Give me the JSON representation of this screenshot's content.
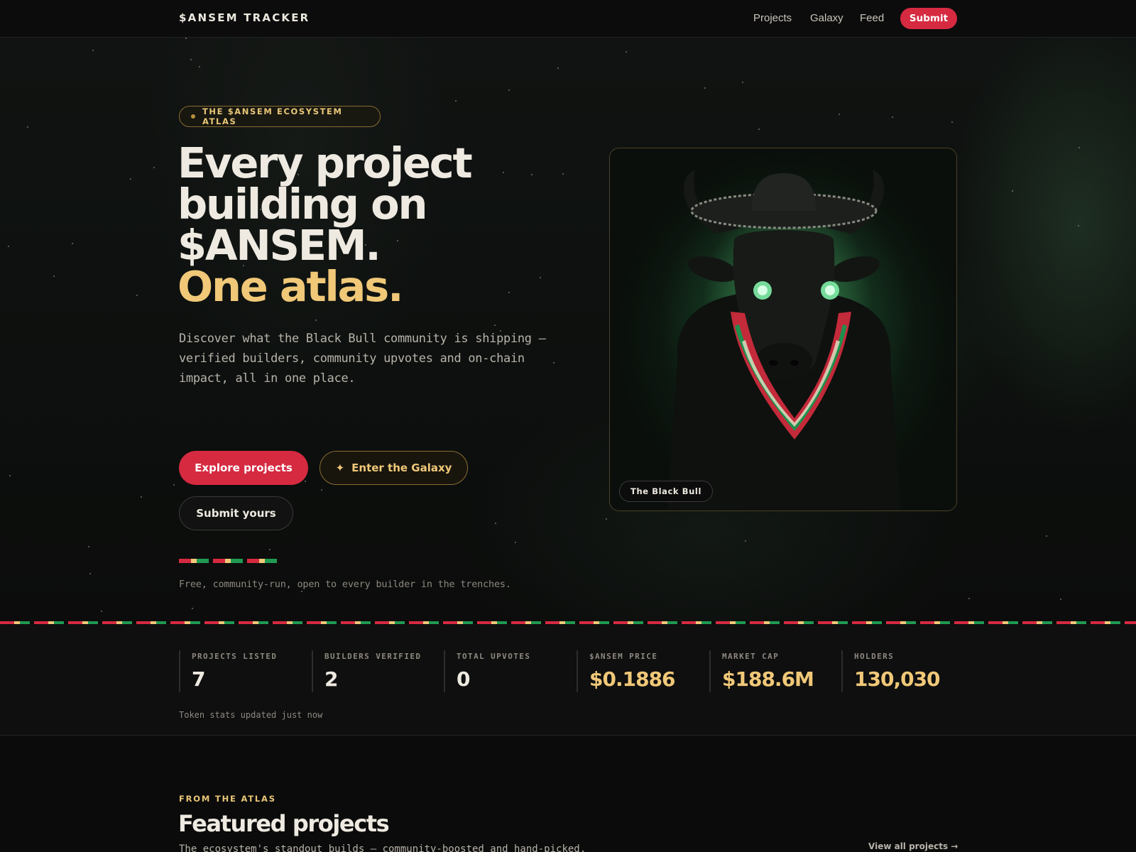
{
  "nav": {
    "brand": "$ANSEM TRACKER",
    "links": [
      "Projects",
      "Galaxy",
      "Feed"
    ],
    "submit_label": "Submit"
  },
  "hero": {
    "eyebrow": "THE $ANSEM ECOSYSTEM ATLAS",
    "headline_lines": [
      "Every project",
      "building on",
      "$ANSEM."
    ],
    "headline_accent": "One atlas.",
    "lede": "Discover what the Black Bull community is shipping — verified builders, community upvotes and on-chain impact, all in one place.",
    "buttons": {
      "explore": "Explore projects",
      "galaxy": "Enter the Galaxy",
      "submit": "Submit yours"
    },
    "galaxy_icon": "sparkle-icon",
    "footnote": "Free, community-run, open to every builder in the trenches.",
    "image_caption": "The Black Bull"
  },
  "colors": {
    "accent_red": "#d62a41",
    "accent_gold": "#f0c878",
    "accent_green": "#1f9a52",
    "background": "#0b0b0b"
  },
  "stats": {
    "items": [
      {
        "label": "PROJECTS LISTED",
        "value": "7"
      },
      {
        "label": "BUILDERS VERIFIED",
        "value": "2"
      },
      {
        "label": "TOTAL UPVOTES",
        "value": "0"
      },
      {
        "label": "$ANSEM PRICE",
        "value": "$0.1886"
      },
      {
        "label": "MARKET CAP",
        "value": "$188.6M"
      },
      {
        "label": "HOLDERS",
        "value": "130,030"
      }
    ],
    "note": "Token stats updated just now"
  },
  "featured": {
    "eyebrow": "FROM THE ATLAS",
    "title": "Featured projects",
    "subtitle": "The ecosystem's standout builds — community-boosted and hand-picked.",
    "view_all": "View all projects →"
  }
}
